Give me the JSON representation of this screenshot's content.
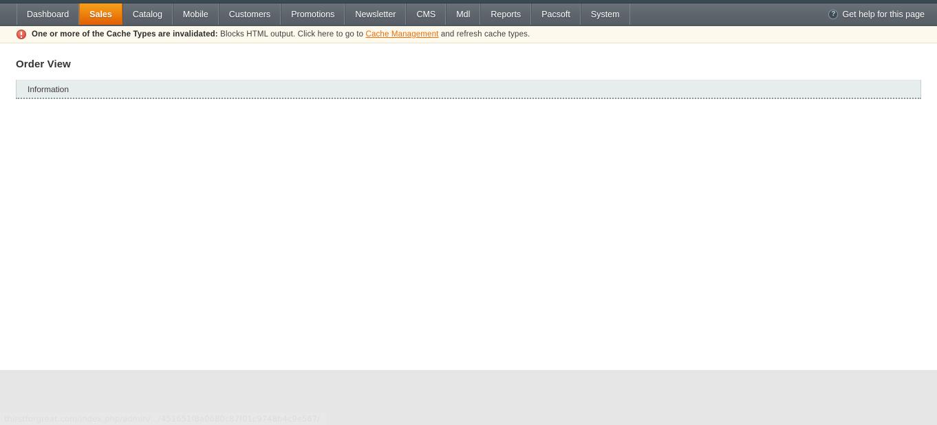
{
  "nav": {
    "items": [
      {
        "label": "Dashboard",
        "active": false
      },
      {
        "label": "Sales",
        "active": true
      },
      {
        "label": "Catalog",
        "active": false
      },
      {
        "label": "Mobile",
        "active": false
      },
      {
        "label": "Customers",
        "active": false
      },
      {
        "label": "Promotions",
        "active": false
      },
      {
        "label": "Newsletter",
        "active": false
      },
      {
        "label": "CMS",
        "active": false
      },
      {
        "label": "Mdl",
        "active": false
      },
      {
        "label": "Reports",
        "active": false
      },
      {
        "label": "Pacsoft",
        "active": false
      },
      {
        "label": "System",
        "active": false
      }
    ],
    "help": {
      "label": "Get help for this page",
      "icon": "question-mark-circle-icon"
    },
    "active_color": "#ee7f0b",
    "bar_color": "#5e656d"
  },
  "notice": {
    "icon": "error-exclamation-icon",
    "strong": "One or more of the Cache Types are invalidated:",
    "text_before_link": " Blocks HTML output. Click here to go to ",
    "link_label": "Cache Management",
    "text_after_link": " and refresh cache types.",
    "link_color": "#eb6e08",
    "background": "#fdf9ec"
  },
  "main": {
    "title": "Order View",
    "tabs": [
      {
        "label": "Information",
        "active": true
      }
    ]
  },
  "status_bar": {
    "url": "thirstforgreat.com/index.php/admin/.../451651f8a0680c87f01c9748b4c9e567/"
  }
}
